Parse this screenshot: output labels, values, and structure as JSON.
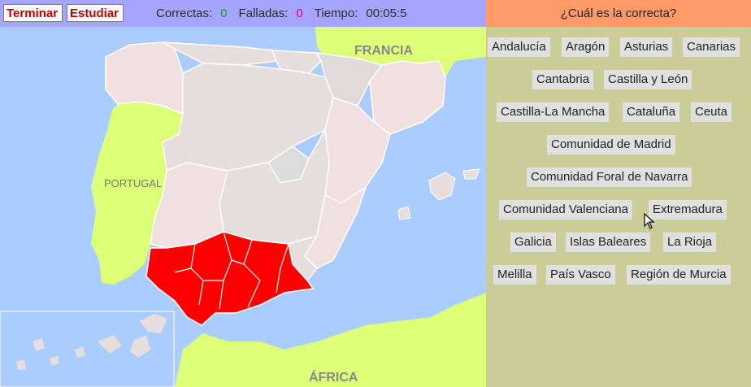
{
  "toolbar": {
    "terminar_label": "Terminar",
    "estudiar_label": "Estudiar"
  },
  "stats": {
    "correct_label": "Correctas:",
    "correct_value": "0",
    "failed_label": "Falladas:",
    "failed_value": "0",
    "time_label": "Tiempo:",
    "time_value": "00:05:5"
  },
  "map": {
    "label_francia": "FRANCIA",
    "label_portugal": "PORTUGAL",
    "label_africa": "ÁFRICA",
    "highlighted_region": "Andalucía",
    "colors": {
      "sea": "#aaccff",
      "foreign_land": "#ddff77",
      "region_fill": "#e6dedc",
      "highlight": "#ff0000",
      "border": "#ffffff"
    }
  },
  "panel": {
    "question": "¿Cuál es la correcta?",
    "options": [
      "Andalucía",
      "Aragón",
      "Asturias",
      "Canarias",
      "Cantabria",
      "Castilla y León",
      "Castilla-La Mancha",
      "Cataluña",
      "Ceuta",
      "Comunidad de Madrid",
      "Comunidad Foral de Navarra",
      "Comunidad Valenciana",
      "Extremadura",
      "Galicia",
      "Islas Baleares",
      "La Rioja",
      "Melilla",
      "País Vasco",
      "Región de Murcia"
    ]
  },
  "colors": {
    "topbar": "#a5a5ff",
    "panel_header": "#ff9966",
    "panel_bg": "#cccc99",
    "button_text": "#c00000"
  }
}
